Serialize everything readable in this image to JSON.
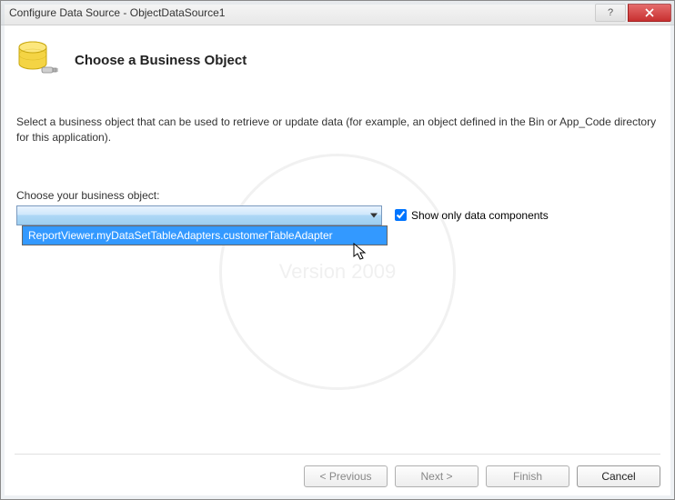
{
  "window": {
    "title": "Configure Data Source - ObjectDataSource1"
  },
  "header": {
    "title": "Choose a Business Object"
  },
  "instruction": "Select a business object that can be used to retrieve or update data (for example, an object defined in the Bin or App_Code directory for this application).",
  "field": {
    "label": "Choose your business object:",
    "selected": "",
    "options": [
      "ReportViewer.myDataSetTableAdapters.customerTableAdapter"
    ]
  },
  "checkbox": {
    "label": "Show only data components",
    "checked": true
  },
  "buttons": {
    "previous": "< Previous",
    "next": "Next >",
    "finish": "Finish",
    "cancel": "Cancel"
  },
  "watermark": {
    "line1": "Version 2009"
  }
}
